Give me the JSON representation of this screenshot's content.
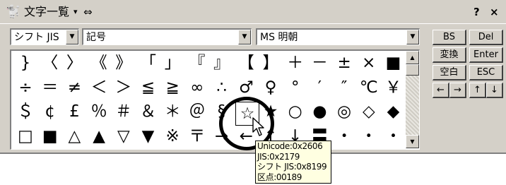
{
  "titlebar": {
    "icon": "🐩",
    "title": "文字一覧",
    "menu_arrow": "▾",
    "extra_icon": "⇔",
    "help": "?",
    "close": "×"
  },
  "toolbar": {
    "encoding": "シフト JIS",
    "category": "記号",
    "font": "MS 明朝",
    "dropdown_arrow": "▼"
  },
  "grid": {
    "rows": [
      [
        "}",
        "〈",
        "〉",
        "《",
        "》",
        "「",
        "」",
        "『",
        "』",
        "【",
        "】",
        "＋",
        "－",
        "±",
        "×",
        "■"
      ],
      [
        "÷",
        "＝",
        "≠",
        "＜",
        "＞",
        "≦",
        "≧",
        "∞",
        "∴",
        "♂",
        "♀",
        "°",
        "′",
        "″",
        "℃",
        "￥"
      ],
      [
        "＄",
        "¢",
        "£",
        "％",
        "＃",
        "＆",
        "＊",
        "＠",
        "§",
        "☆",
        "★",
        "○",
        "●",
        "◎",
        "◇",
        "◆"
      ],
      [
        "□",
        "■",
        "△",
        "▲",
        "▽",
        "▼",
        "※",
        "〒",
        "→",
        "←",
        "↑",
        "↓",
        "〓",
        "・",
        "・",
        "・"
      ]
    ],
    "selected": "☆",
    "scroll_up": "▲",
    "scroll_down": "▼"
  },
  "keys": {
    "bs": "BS",
    "del": "Del",
    "henkan": "変換",
    "enter": "Enter",
    "space": "空白",
    "esc": "ESC",
    "left": "←",
    "right": "→",
    "up": "↑",
    "down": "↓"
  },
  "tooltip": {
    "unicode": "Unicode:0x2606",
    "jis": "JIS:0x2179",
    "sjis": "シフト JIS:0x8199",
    "kuten": "区点:00189"
  }
}
